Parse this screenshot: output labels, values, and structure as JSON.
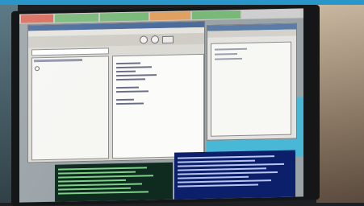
{
  "scene": {
    "description_colors": {
      "bezel": "#151617",
      "screen_bg": "#9aa3a8",
      "terminal_left": "#0f2a1e",
      "terminal_right": "#0b1f6b",
      "desktop_cyan": "#49b8d6"
    }
  },
  "taskbar": {
    "tabs": [
      {
        "label": "",
        "color": "#d96a5a"
      },
      {
        "label": "",
        "color": "#79b879"
      },
      {
        "label": "",
        "color": "#79b879"
      },
      {
        "label": "",
        "color": "#e0a060"
      },
      {
        "label": "",
        "color": "#79b879"
      },
      {
        "label": "",
        "color": "#cfcfcf"
      }
    ]
  },
  "icons": [
    "circle-tool-icon",
    "circle-tool-icon-2",
    "toolbar-button-icon"
  ]
}
